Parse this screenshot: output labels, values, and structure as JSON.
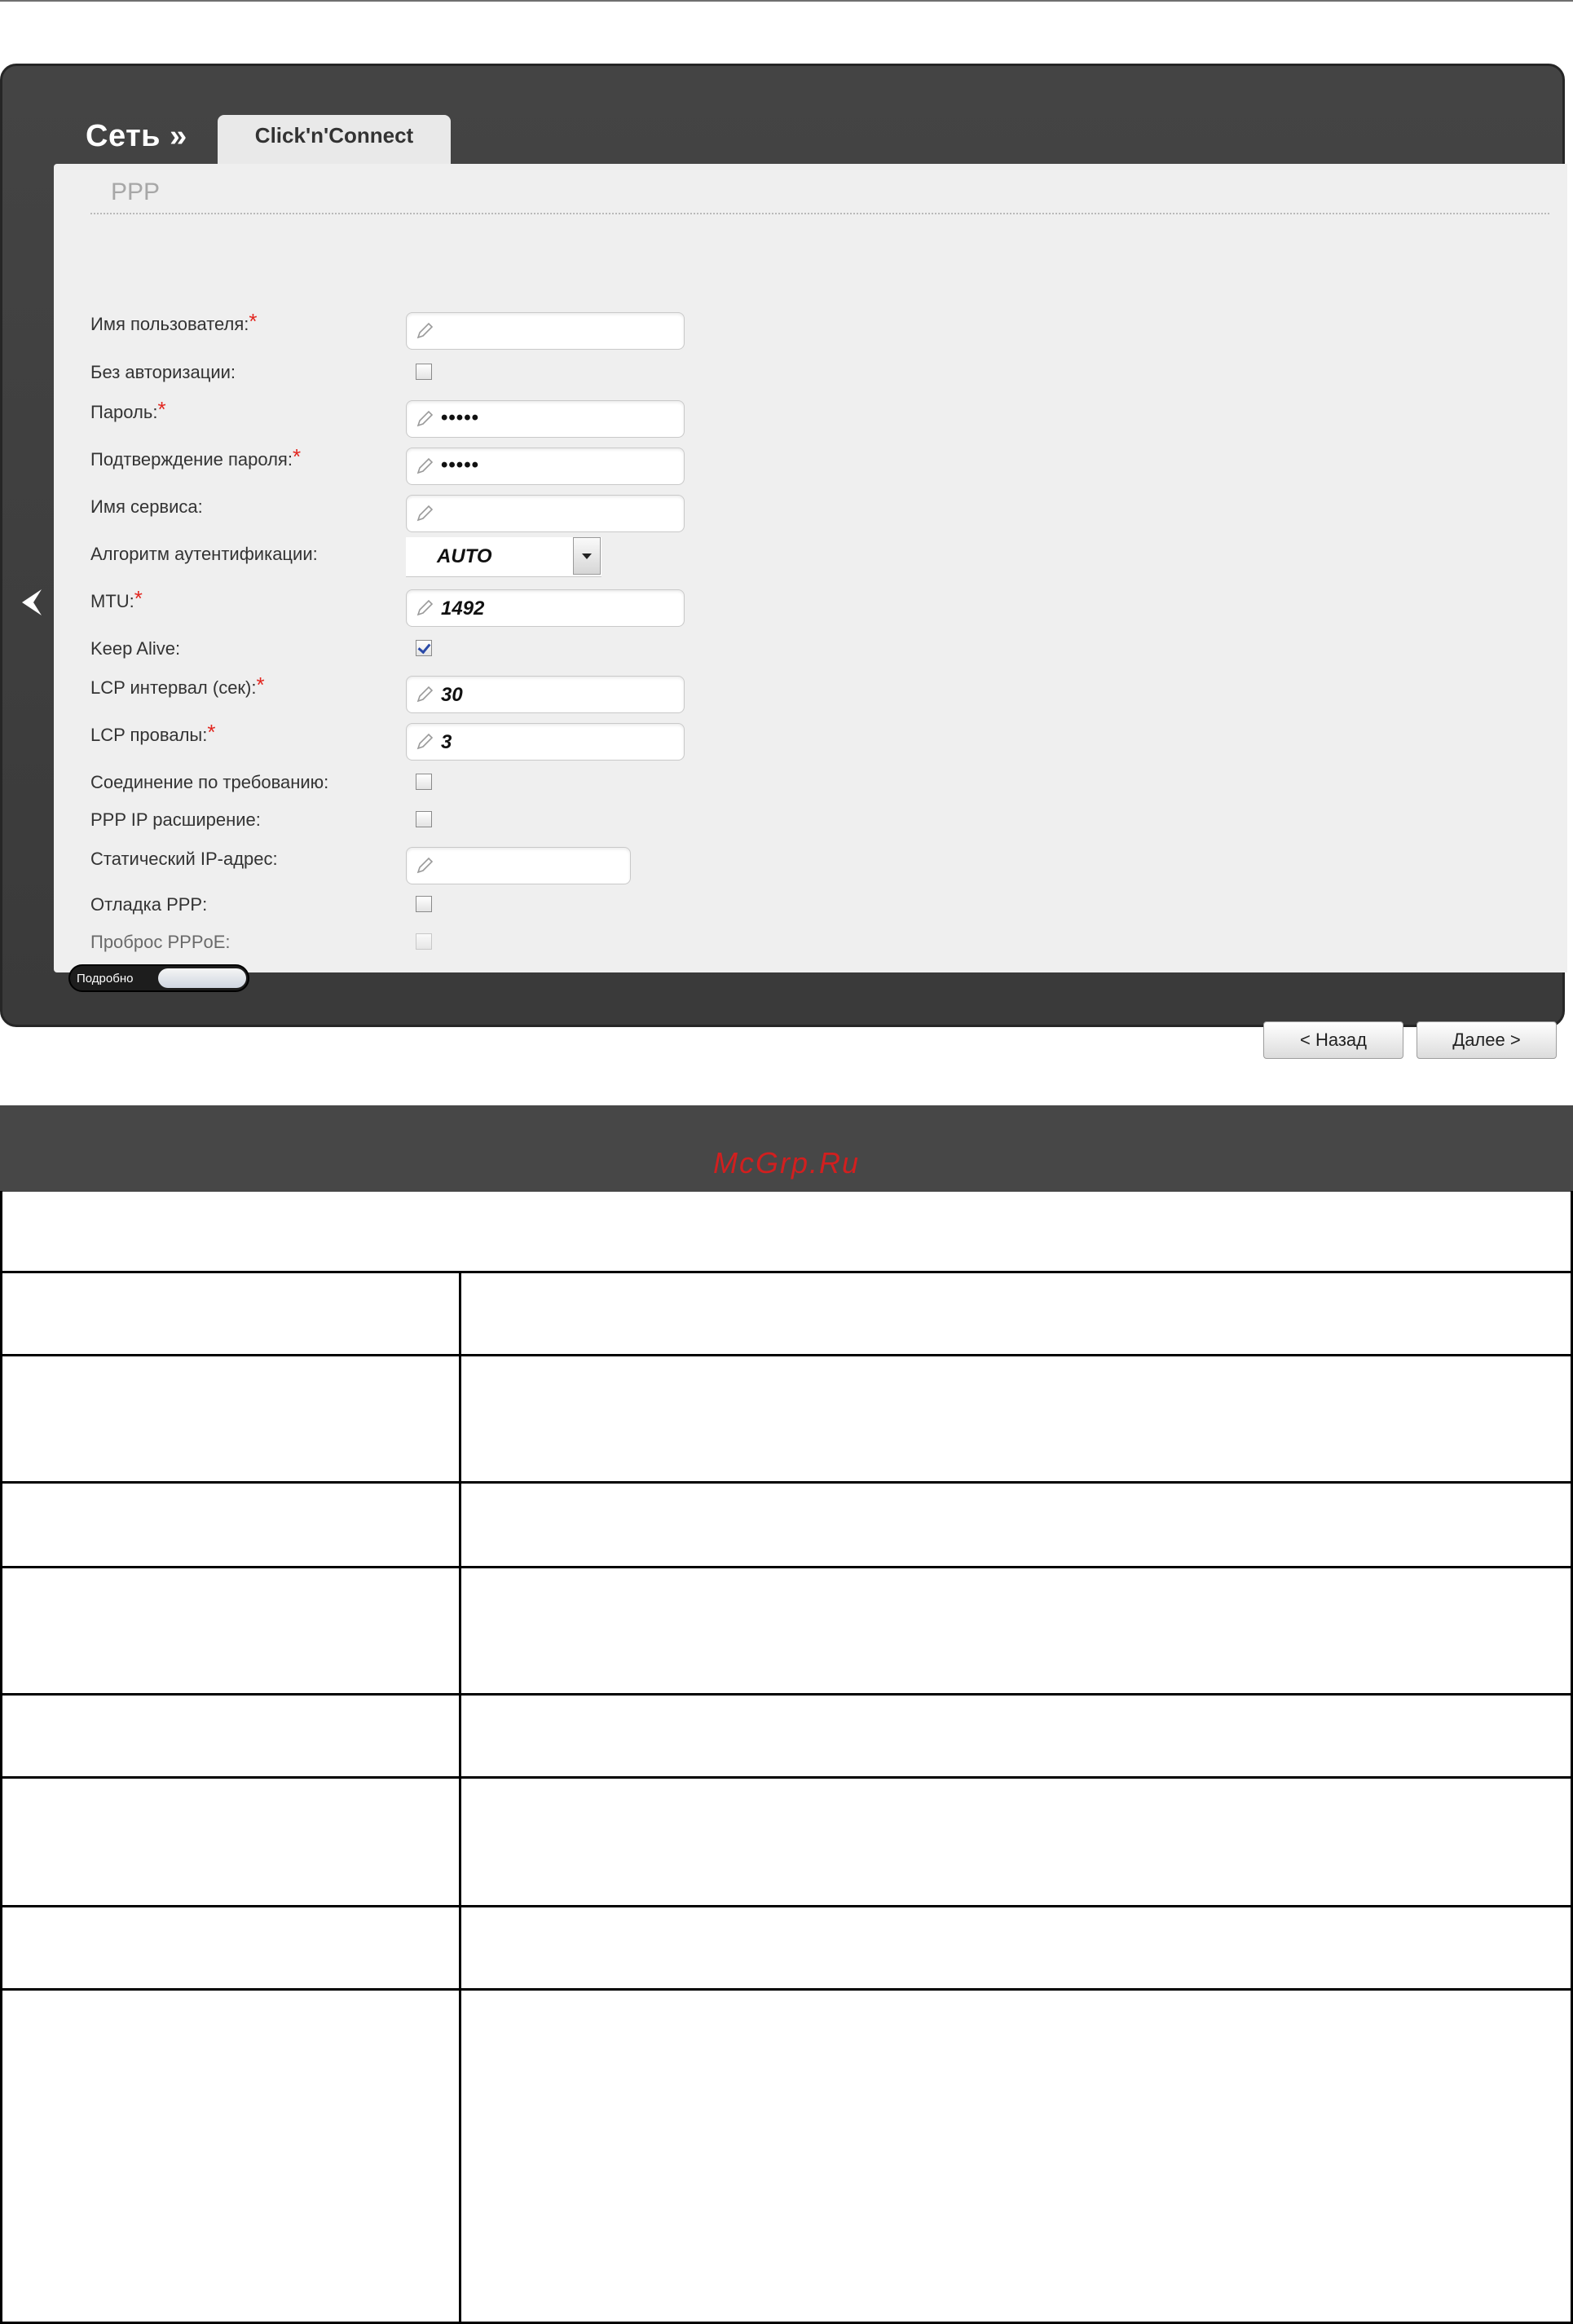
{
  "header": {
    "breadcrumb": "Сеть »",
    "tab": "Click'n'Connect"
  },
  "section": {
    "title": "PPP"
  },
  "form": {
    "username": {
      "label": "Имя пользователя:",
      "value": ""
    },
    "no_auth": {
      "label": "Без авторизации:",
      "checked": false
    },
    "password": {
      "label": "Пароль:",
      "value": "•••••"
    },
    "password_confirm": {
      "label": "Подтверждение пароля:",
      "value": "•••••"
    },
    "service_name": {
      "label": "Имя сервиса:",
      "value": ""
    },
    "auth_algorithm": {
      "label": "Алгоритм аутентификации:",
      "value": "AUTO"
    },
    "mtu": {
      "label": "MTU:",
      "value": "1492"
    },
    "keep_alive": {
      "label": "Keep Alive:",
      "checked": true
    },
    "lcp_interval": {
      "label": "LCP интервал (сек):",
      "value": "30"
    },
    "lcp_failures": {
      "label": "LCP провалы:",
      "value": "3"
    },
    "on_demand": {
      "label": "Соединение по требованию:",
      "checked": false
    },
    "ppp_ip_ext": {
      "label": "PPP IP расширение:",
      "checked": false
    },
    "static_ip": {
      "label": "Статический IP-адрес:",
      "value": ""
    },
    "ppp_debug": {
      "label": "Отладка PPP:",
      "checked": false
    },
    "pppoe_passthrough": {
      "label": "Проброс PPPoE:",
      "checked": false
    },
    "required_mark": "*"
  },
  "footer": {
    "details_toggle": "Подробно",
    "back_button": "< Назад",
    "next_button": "Далее >"
  },
  "watermark": "McGrp.Ru",
  "colors": {
    "frame": "#3b3b3b",
    "panel": "#efefef",
    "required": "#e2261f",
    "watermark": "#d11f1f",
    "table_header": "#474747"
  }
}
